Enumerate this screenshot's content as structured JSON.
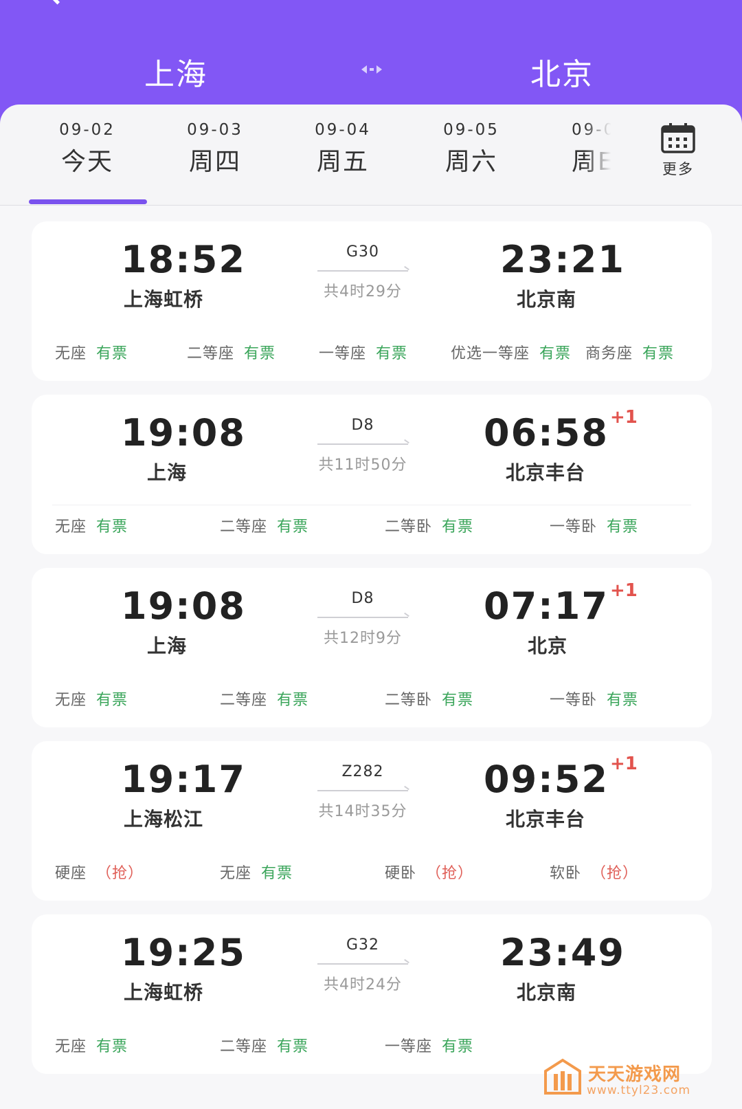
{
  "header": {
    "from_city": "上海",
    "to_city": "北京",
    "swap_icon": "swap-arrows-icon",
    "back_icon": "back-arrow-icon",
    "bg_color": "#8257f5"
  },
  "dates": [
    {
      "date": "09-02",
      "label": "今天",
      "selected": true
    },
    {
      "date": "09-03",
      "label": "周四",
      "selected": false
    },
    {
      "date": "09-04",
      "label": "周五",
      "selected": false
    },
    {
      "date": "09-05",
      "label": "周六",
      "selected": false
    },
    {
      "date": "09-0",
      "label": "周E",
      "selected": false
    }
  ],
  "more": {
    "label": "更多",
    "icon": "calendar-icon"
  },
  "trains": [
    {
      "dep_time": "18:52",
      "dep_station": "上海虹桥",
      "train_no": "G30",
      "duration": "共4时29分",
      "arr_time": "23:21",
      "arr_station": "北京南",
      "next_day": "",
      "seats": [
        {
          "name": "无座",
          "status": "有票",
          "type": "avail"
        },
        {
          "name": "二等座",
          "status": "有票",
          "type": "avail"
        },
        {
          "name": "一等座",
          "status": "有票",
          "type": "avail"
        },
        {
          "name": "优选一等座",
          "status": "有票",
          "type": "avail"
        },
        {
          "name": "商务座",
          "status": "有票",
          "type": "avail"
        }
      ]
    },
    {
      "dep_time": "19:08",
      "dep_station": "上海",
      "train_no": "D8",
      "duration": "共11时50分",
      "arr_time": "06:58",
      "arr_station": "北京丰台",
      "next_day": "+1",
      "seats": [
        {
          "name": "无座",
          "status": "有票",
          "type": "avail"
        },
        {
          "name": "二等座",
          "status": "有票",
          "type": "avail"
        },
        {
          "name": "二等卧",
          "status": "有票",
          "type": "avail"
        },
        {
          "name": "一等卧",
          "status": "有票",
          "type": "avail"
        }
      ]
    },
    {
      "dep_time": "19:08",
      "dep_station": "上海",
      "train_no": "D8",
      "duration": "共12时9分",
      "arr_time": "07:17",
      "arr_station": "北京",
      "next_day": "+1",
      "seats": [
        {
          "name": "无座",
          "status": "有票",
          "type": "avail"
        },
        {
          "name": "二等座",
          "status": "有票",
          "type": "avail"
        },
        {
          "name": "二等卧",
          "status": "有票",
          "type": "avail"
        },
        {
          "name": "一等卧",
          "status": "有票",
          "type": "avail"
        }
      ]
    },
    {
      "dep_time": "19:17",
      "dep_station": "上海松江",
      "train_no": "Z282",
      "duration": "共14时35分",
      "arr_time": "09:52",
      "arr_station": "北京丰台",
      "next_day": "+1",
      "seats": [
        {
          "name": "硬座",
          "status": "（抢）",
          "type": "grab"
        },
        {
          "name": "无座",
          "status": "有票",
          "type": "avail"
        },
        {
          "name": "硬卧",
          "status": "（抢）",
          "type": "grab"
        },
        {
          "name": "软卧",
          "status": "（抢）",
          "type": "grab"
        }
      ]
    },
    {
      "dep_time": "19:25",
      "dep_station": "上海虹桥",
      "train_no": "G32",
      "duration": "共4时24分",
      "arr_time": "23:49",
      "arr_station": "北京南",
      "next_day": "",
      "seats": [
        {
          "name": "无座",
          "status": "有票",
          "type": "avail"
        },
        {
          "name": "二等座",
          "status": "有票",
          "type": "avail"
        },
        {
          "name": "一等座",
          "status": "有票",
          "type": "avail"
        }
      ]
    }
  ],
  "watermark": {
    "text": "天天游戏网",
    "url": "www.ttyl23.com"
  },
  "colors": {
    "accent": "#7a52ee",
    "available": "#3aa55a",
    "grab": "#e0615a",
    "next_day": "#e2534d"
  }
}
